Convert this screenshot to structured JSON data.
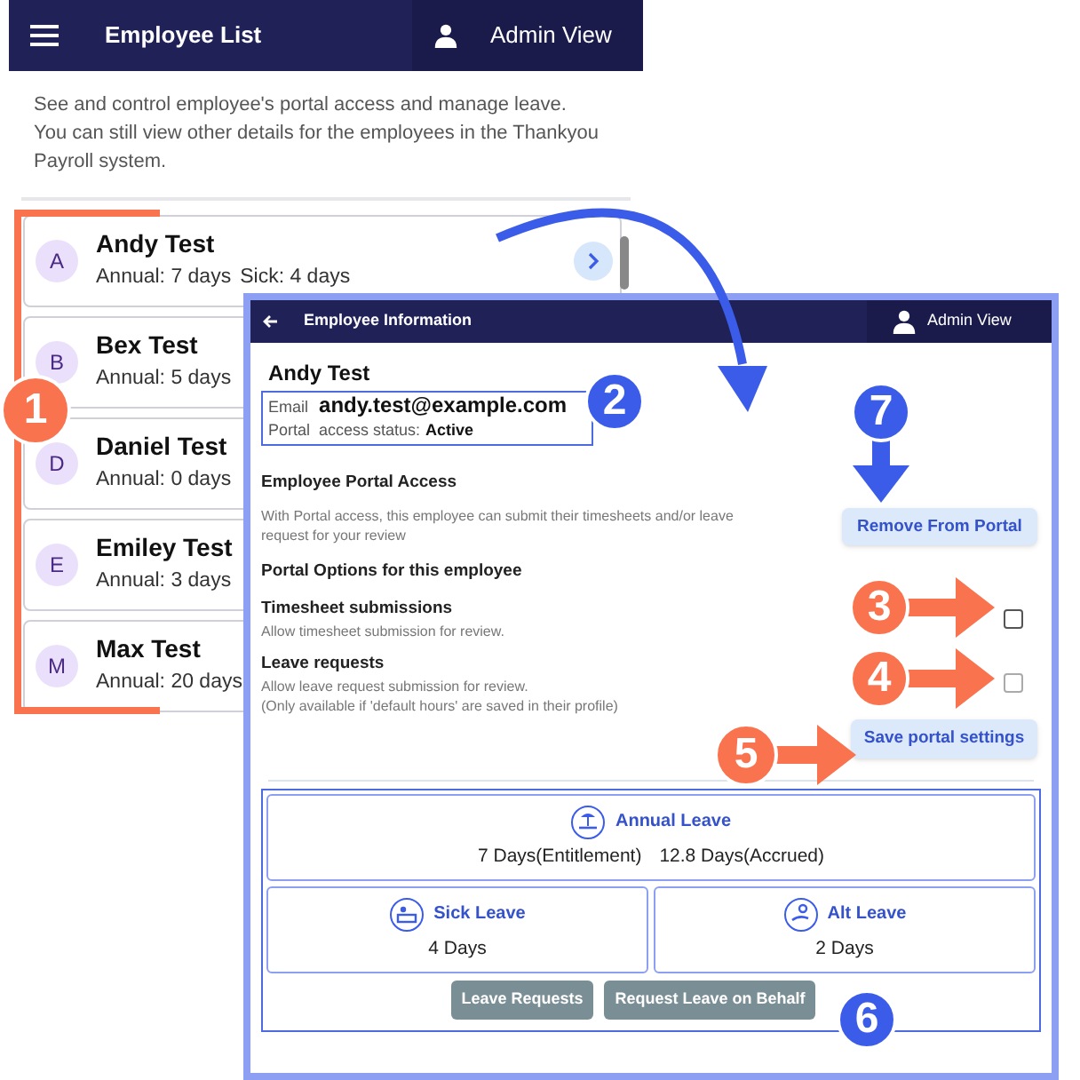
{
  "app_bar": {
    "title": "Employee List",
    "user_label": "Admin View"
  },
  "intro": [
    "See and control employee's portal access and manage leave.",
    "You can still view other details for the employees in the Thankyou Payroll system."
  ],
  "employees": [
    {
      "initial": "A",
      "name": "Andy Test",
      "annual": "Annual: 7 days",
      "sick": "Sick: 4 days"
    },
    {
      "initial": "B",
      "name": "Bex Test",
      "annual": "Annual: 5 days"
    },
    {
      "initial": "D",
      "name": "Daniel Test",
      "annual": "Annual: 0 days"
    },
    {
      "initial": "E",
      "name": "Emiley Test",
      "annual": "Annual: 3 days"
    },
    {
      "initial": "M",
      "name": "Max Test",
      "annual": "Annual: 20 days"
    }
  ],
  "detail": {
    "title": "Employee Information",
    "user_label": "Admin View",
    "name": "Andy Test",
    "email_label": "Email",
    "email": "andy.test@example.com",
    "status_label": "Portal  access status:",
    "status": "Active",
    "access_heading": "Employee Portal Access",
    "access_text": "With Portal access, this employee can submit their timesheets and/or leave request for your review",
    "remove_button": "Remove From Portal",
    "options_heading": "Portal Options for this employee",
    "options": [
      {
        "title": "Timesheet submissions",
        "description": [
          "Allow timesheet submission for review."
        ],
        "checked": false
      },
      {
        "title": "Leave requests",
        "description": [
          "Allow leave request submission for review.",
          "(Only available if 'default hours' are saved in their profile)"
        ],
        "checked": false
      }
    ],
    "save_button": "Save portal settings",
    "leave": [
      {
        "kind": "annual",
        "title": "Annual Leave",
        "values": [
          "7 Days(Entitlement)",
          "12.8 Days(Accrued)"
        ]
      },
      {
        "kind": "sick",
        "title": "Sick Leave",
        "values": [
          "4 Days"
        ]
      },
      {
        "kind": "alt",
        "title": "Alt Leave",
        "values": [
          "2 Days"
        ]
      }
    ],
    "actions": [
      "Leave Requests",
      "Request Leave on Behalf"
    ]
  },
  "callouts": [
    {
      "label": "1",
      "color": "#f9734e"
    },
    {
      "label": "2",
      "color": "#3b5ce8"
    },
    {
      "label": "7",
      "color": "#3b5ce8"
    },
    {
      "label": "3",
      "color": "#f9734e"
    },
    {
      "label": "4",
      "color": "#f9734e"
    },
    {
      "label": "5",
      "color": "#f9734e"
    },
    {
      "label": "6",
      "color": "#3b5ce8"
    }
  ]
}
